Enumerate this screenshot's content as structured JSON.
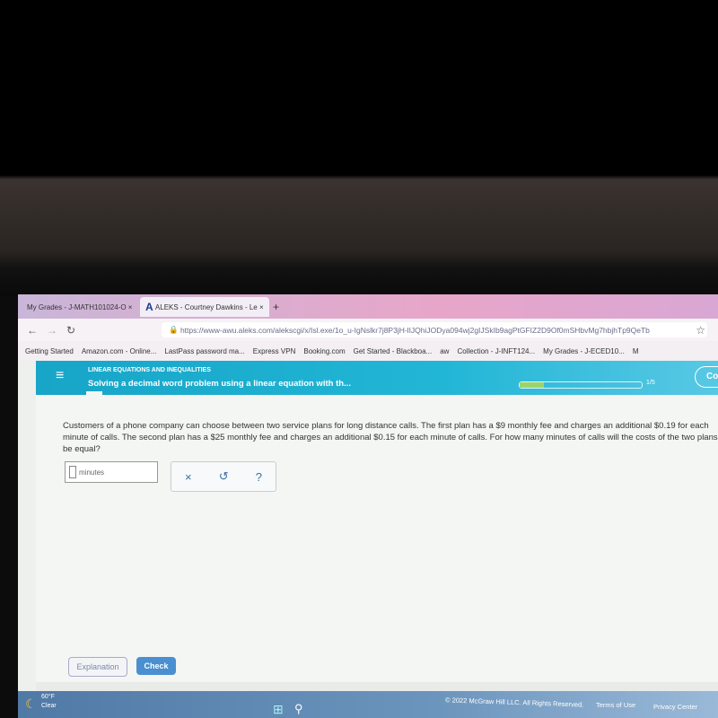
{
  "tabs": [
    {
      "label": "My Grades - J-MATH101024-O"
    },
    {
      "label": "ALEKS - Courtney Dawkins - Le"
    }
  ],
  "url": "https://www-awu.aleks.com/alekscgi/x/Isl.exe/1o_u-IgNslkr7j8P3jH-lIJQhiJODya094wj2gIJSkIb9agPtGFIZ2D9Of0mSHbvMg7hbjhTp9QeTb",
  "bookmarks": [
    "Getting Started",
    "Amazon.com - Online...",
    "LastPass password ma...",
    "Express VPN",
    "Booking.com",
    "Get Started - Blackboa...",
    "aw",
    "Collection - J-INFT124...",
    "My Grades - J-ECED10...",
    "M"
  ],
  "header": {
    "topic": "LINEAR EQUATIONS AND INEQUALITIES",
    "title": "Solving a decimal word problem using a linear equation with th...",
    "progress": "1/5",
    "progress_fraction": 0.2,
    "cta": "Co"
  },
  "question": "Customers of a phone company can choose between two service plans for long distance calls. The first plan has a $9 monthly fee and charges an additional $0.19 for each minute of calls. The second plan has a $25 monthly fee and charges an additional $0.15 for each minute of calls. For how many minutes of calls will the costs of the two plans be equal?",
  "answer": {
    "value": "",
    "unit": "minutes"
  },
  "tools": {
    "clear": "×",
    "undo": "↺",
    "help": "?"
  },
  "buttons": {
    "explanation": "Explanation",
    "check": "Check"
  },
  "footer": {
    "copyright": "© 2022 McGraw Hill LLC. All Rights Reserved.",
    "terms": "Terms of Use",
    "privacy": "Privacy Center"
  },
  "weather": {
    "temp": "60°F",
    "condition": "Clear"
  },
  "colors": {
    "header": "#1aa9cc",
    "check": "#4a8fd0"
  }
}
